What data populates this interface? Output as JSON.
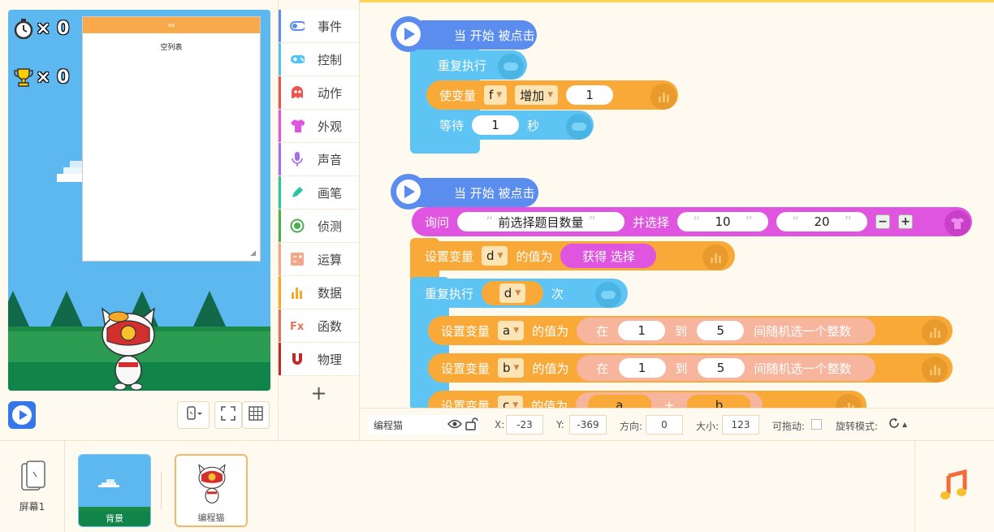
{
  "stage": {
    "timer_label": "× 0",
    "trophy_label": "× 0",
    "list_header": "aa",
    "list_empty": "空列表"
  },
  "categories": [
    {
      "label": "事件",
      "color": "#5b8def",
      "icon": "toggle-icon"
    },
    {
      "label": "控制",
      "color": "#4fc3f7",
      "icon": "gamepad-icon"
    },
    {
      "label": "动作",
      "color": "#ef5350",
      "icon": "ghost-icon"
    },
    {
      "label": "外观",
      "color": "#e055e0",
      "icon": "shirt-icon"
    },
    {
      "label": "声音",
      "color": "#a66cf0",
      "icon": "microphone-icon"
    },
    {
      "label": "画笔",
      "color": "#26c6a0",
      "icon": "pen-icon"
    },
    {
      "label": "侦测",
      "color": "#4caf50",
      "icon": "target-icon"
    },
    {
      "label": "运算",
      "color": "#f4a688",
      "icon": "calculator-icon"
    },
    {
      "label": "数据",
      "color": "#f9a825",
      "icon": "bar-chart-icon"
    },
    {
      "label": "函数",
      "color": "#e0735a",
      "icon": "function-icon"
    },
    {
      "label": "物理",
      "color": "#c62828",
      "icon": "magnet-icon"
    }
  ],
  "script1": {
    "hat": "当 开始 被点击",
    "repeat": "重复执行",
    "change_label": "使变量",
    "change_var": "f",
    "change_op": "增加",
    "change_val": "1",
    "wait_label": "等待",
    "wait_val": "1",
    "wait_unit": "秒"
  },
  "script2": {
    "hat": "当 开始 被点击",
    "ask_label": "询问",
    "ask_text": "前选择题目数量",
    "ask_choose": "并选择",
    "ask_opt1": "10",
    "ask_opt2": "20",
    "set_label": "设置变量",
    "set_var_d": "d",
    "value_of": "的值为",
    "get_choice": "获得 选择",
    "repeat_label": "重复执行",
    "repeat_var": "d",
    "repeat_unit": "次",
    "set_var_a": "a",
    "set_var_b": "b",
    "set_var_c": "c",
    "rand_in": "在",
    "rand_from": "1",
    "rand_to_label": "到",
    "rand_to": "5",
    "rand_desc": "间随机选一个整数",
    "op_plus": "+"
  },
  "props": {
    "sprite_name": "编程猫",
    "x_label": "X:",
    "x_value": "-23",
    "y_label": "Y:",
    "y_value": "-369",
    "dir_label": "方向:",
    "dir_value": "0",
    "size_label": "大小:",
    "size_value": "123",
    "draggable_label": "可拖动:",
    "rotation_label": "旋转模式:"
  },
  "bottom": {
    "screen_label": "屏幕1",
    "background_label": "背景",
    "sprite_label": "编程猫"
  }
}
